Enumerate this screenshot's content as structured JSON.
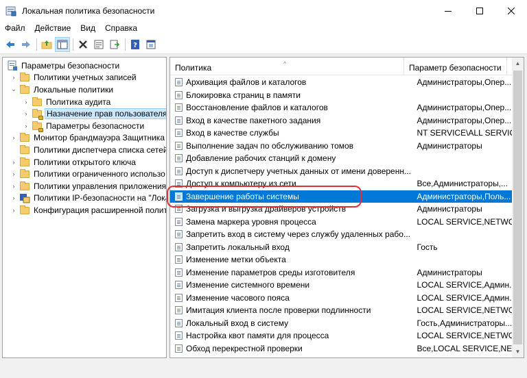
{
  "window": {
    "title": "Локальная политика безопасности"
  },
  "menu": [
    "Файл",
    "Действие",
    "Вид",
    "Справка"
  ],
  "tree": [
    {
      "label": "Параметры безопасности",
      "level": 0,
      "expander": "",
      "icon": "security-settings-icon"
    },
    {
      "label": "Политики учетных записей",
      "level": 1,
      "expander": "›",
      "icon": "folder-icon"
    },
    {
      "label": "Локальные политики",
      "level": 1,
      "expander": "⌄",
      "icon": "folder-icon"
    },
    {
      "label": "Политика аудита",
      "level": 2,
      "expander": "›",
      "icon": "folder-icon"
    },
    {
      "label": "Назначение прав пользователя",
      "level": 2,
      "expander": "›",
      "icon": "folder-lock-icon",
      "selected": true
    },
    {
      "label": "Параметры безопасности",
      "level": 2,
      "expander": "›",
      "icon": "folder-lock-icon"
    },
    {
      "label": "Монитор брандмауэра Защитника W",
      "level": 1,
      "expander": "›",
      "icon": "folder-icon"
    },
    {
      "label": "Политики диспетчера списка сетей",
      "level": 1,
      "expander": "",
      "icon": "folder-icon"
    },
    {
      "label": "Политики открытого ключа",
      "level": 1,
      "expander": "›",
      "icon": "folder-icon"
    },
    {
      "label": "Политики ограниченного использо",
      "level": 1,
      "expander": "›",
      "icon": "folder-icon"
    },
    {
      "label": "Политики управления приложения",
      "level": 1,
      "expander": "›",
      "icon": "folder-icon"
    },
    {
      "label": "Политики IP-безопасности на \"Лока",
      "level": 1,
      "expander": "›",
      "icon": "ipsec-icon"
    },
    {
      "label": "Конфигурация расширенной полит",
      "level": 1,
      "expander": "›",
      "icon": "folder-icon"
    }
  ],
  "list": {
    "columns": [
      "Политика",
      "Параметр безопасности"
    ],
    "rows": [
      {
        "policy": "Архивация файлов и каталогов",
        "value": "Администраторы,Опер..."
      },
      {
        "policy": "Блокировка страниц в памяти",
        "value": ""
      },
      {
        "policy": "Восстановление файлов и каталогов",
        "value": "Администраторы,Опер..."
      },
      {
        "policy": "Вход в качестве пакетного задания",
        "value": "Администраторы,Опер..."
      },
      {
        "policy": "Вход в качестве службы",
        "value": "NT SERVICE\\ALL SERVICES"
      },
      {
        "policy": "Выполнение задач по обслуживанию томов",
        "value": "Администраторы"
      },
      {
        "policy": "Добавление рабочих станций к домену",
        "value": ""
      },
      {
        "policy": "Доступ к диспетчеру учетных данных от имени доверенн...",
        "value": ""
      },
      {
        "policy": "Доступ к компьютеру из сети",
        "value": "Все,Администраторы,..."
      },
      {
        "policy": "Завершение работы системы",
        "value": "Администраторы,Поль...",
        "selected": true
      },
      {
        "policy": "Загрузка и выгрузка драйверов устройств",
        "value": "Администраторы"
      },
      {
        "policy": "Замена маркера уровня процесса",
        "value": "LOCAL SERVICE,NETWO..."
      },
      {
        "policy": "Запретить вход в систему через службу удаленных рабо...",
        "value": ""
      },
      {
        "policy": "Запретить локальный вход",
        "value": "Гость"
      },
      {
        "policy": "Изменение метки объекта",
        "value": ""
      },
      {
        "policy": "Изменение параметров среды изготовителя",
        "value": "Администраторы"
      },
      {
        "policy": "Изменение системного времени",
        "value": "LOCAL SERVICE,Админ..."
      },
      {
        "policy": "Изменение часового пояса",
        "value": "LOCAL SERVICE,Админ..."
      },
      {
        "policy": "Имитация клиента после проверки подлинности",
        "value": "LOCAL SERVICE,NETWO..."
      },
      {
        "policy": "Локальный вход в систему",
        "value": "Гость,Администраторы..."
      },
      {
        "policy": "Настройка квот памяти для процесса",
        "value": "LOCAL SERVICE,NETWO..."
      },
      {
        "policy": "Обход перекрестной проверки",
        "value": "Все,LOCAL SERVICE,NET..."
      }
    ]
  },
  "colors": {
    "selection": "#0078d7",
    "highlight_ring": "#e03030",
    "tree_selection": "#cce8ff"
  }
}
